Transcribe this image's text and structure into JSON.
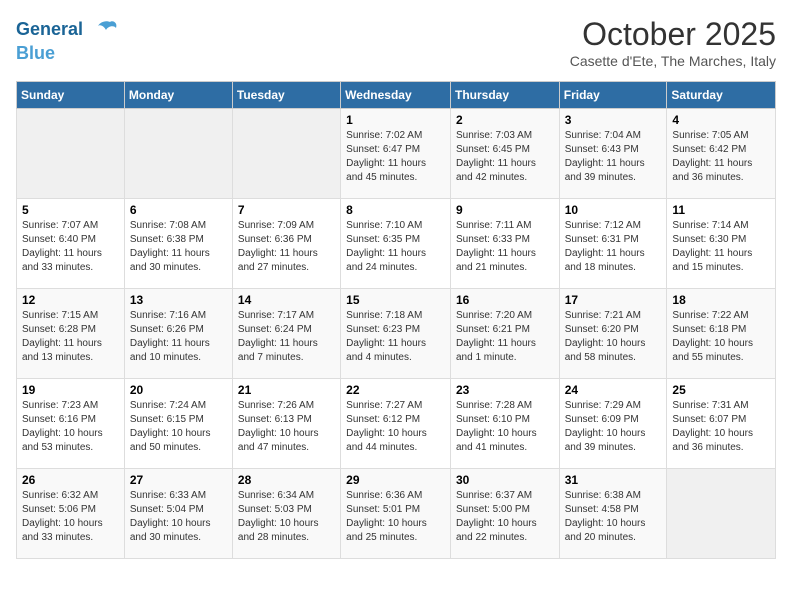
{
  "logo": {
    "line1": "General",
    "line2": "Blue"
  },
  "header": {
    "title": "October 2025",
    "subtitle": "Casette d'Ete, The Marches, Italy"
  },
  "days_of_week": [
    "Sunday",
    "Monday",
    "Tuesday",
    "Wednesday",
    "Thursday",
    "Friday",
    "Saturday"
  ],
  "weeks": [
    [
      {
        "day": "",
        "info": ""
      },
      {
        "day": "",
        "info": ""
      },
      {
        "day": "",
        "info": ""
      },
      {
        "day": "1",
        "info": "Sunrise: 7:02 AM\nSunset: 6:47 PM\nDaylight: 11 hours and 45 minutes."
      },
      {
        "day": "2",
        "info": "Sunrise: 7:03 AM\nSunset: 6:45 PM\nDaylight: 11 hours and 42 minutes."
      },
      {
        "day": "3",
        "info": "Sunrise: 7:04 AM\nSunset: 6:43 PM\nDaylight: 11 hours and 39 minutes."
      },
      {
        "day": "4",
        "info": "Sunrise: 7:05 AM\nSunset: 6:42 PM\nDaylight: 11 hours and 36 minutes."
      }
    ],
    [
      {
        "day": "5",
        "info": "Sunrise: 7:07 AM\nSunset: 6:40 PM\nDaylight: 11 hours and 33 minutes."
      },
      {
        "day": "6",
        "info": "Sunrise: 7:08 AM\nSunset: 6:38 PM\nDaylight: 11 hours and 30 minutes."
      },
      {
        "day": "7",
        "info": "Sunrise: 7:09 AM\nSunset: 6:36 PM\nDaylight: 11 hours and 27 minutes."
      },
      {
        "day": "8",
        "info": "Sunrise: 7:10 AM\nSunset: 6:35 PM\nDaylight: 11 hours and 24 minutes."
      },
      {
        "day": "9",
        "info": "Sunrise: 7:11 AM\nSunset: 6:33 PM\nDaylight: 11 hours and 21 minutes."
      },
      {
        "day": "10",
        "info": "Sunrise: 7:12 AM\nSunset: 6:31 PM\nDaylight: 11 hours and 18 minutes."
      },
      {
        "day": "11",
        "info": "Sunrise: 7:14 AM\nSunset: 6:30 PM\nDaylight: 11 hours and 15 minutes."
      }
    ],
    [
      {
        "day": "12",
        "info": "Sunrise: 7:15 AM\nSunset: 6:28 PM\nDaylight: 11 hours and 13 minutes."
      },
      {
        "day": "13",
        "info": "Sunrise: 7:16 AM\nSunset: 6:26 PM\nDaylight: 11 hours and 10 minutes."
      },
      {
        "day": "14",
        "info": "Sunrise: 7:17 AM\nSunset: 6:24 PM\nDaylight: 11 hours and 7 minutes."
      },
      {
        "day": "15",
        "info": "Sunrise: 7:18 AM\nSunset: 6:23 PM\nDaylight: 11 hours and 4 minutes."
      },
      {
        "day": "16",
        "info": "Sunrise: 7:20 AM\nSunset: 6:21 PM\nDaylight: 11 hours and 1 minute."
      },
      {
        "day": "17",
        "info": "Sunrise: 7:21 AM\nSunset: 6:20 PM\nDaylight: 10 hours and 58 minutes."
      },
      {
        "day": "18",
        "info": "Sunrise: 7:22 AM\nSunset: 6:18 PM\nDaylight: 10 hours and 55 minutes."
      }
    ],
    [
      {
        "day": "19",
        "info": "Sunrise: 7:23 AM\nSunset: 6:16 PM\nDaylight: 10 hours and 53 minutes."
      },
      {
        "day": "20",
        "info": "Sunrise: 7:24 AM\nSunset: 6:15 PM\nDaylight: 10 hours and 50 minutes."
      },
      {
        "day": "21",
        "info": "Sunrise: 7:26 AM\nSunset: 6:13 PM\nDaylight: 10 hours and 47 minutes."
      },
      {
        "day": "22",
        "info": "Sunrise: 7:27 AM\nSunset: 6:12 PM\nDaylight: 10 hours and 44 minutes."
      },
      {
        "day": "23",
        "info": "Sunrise: 7:28 AM\nSunset: 6:10 PM\nDaylight: 10 hours and 41 minutes."
      },
      {
        "day": "24",
        "info": "Sunrise: 7:29 AM\nSunset: 6:09 PM\nDaylight: 10 hours and 39 minutes."
      },
      {
        "day": "25",
        "info": "Sunrise: 7:31 AM\nSunset: 6:07 PM\nDaylight: 10 hours and 36 minutes."
      }
    ],
    [
      {
        "day": "26",
        "info": "Sunrise: 6:32 AM\nSunset: 5:06 PM\nDaylight: 10 hours and 33 minutes."
      },
      {
        "day": "27",
        "info": "Sunrise: 6:33 AM\nSunset: 5:04 PM\nDaylight: 10 hours and 30 minutes."
      },
      {
        "day": "28",
        "info": "Sunrise: 6:34 AM\nSunset: 5:03 PM\nDaylight: 10 hours and 28 minutes."
      },
      {
        "day": "29",
        "info": "Sunrise: 6:36 AM\nSunset: 5:01 PM\nDaylight: 10 hours and 25 minutes."
      },
      {
        "day": "30",
        "info": "Sunrise: 6:37 AM\nSunset: 5:00 PM\nDaylight: 10 hours and 22 minutes."
      },
      {
        "day": "31",
        "info": "Sunrise: 6:38 AM\nSunset: 4:58 PM\nDaylight: 10 hours and 20 minutes."
      },
      {
        "day": "",
        "info": ""
      }
    ]
  ]
}
